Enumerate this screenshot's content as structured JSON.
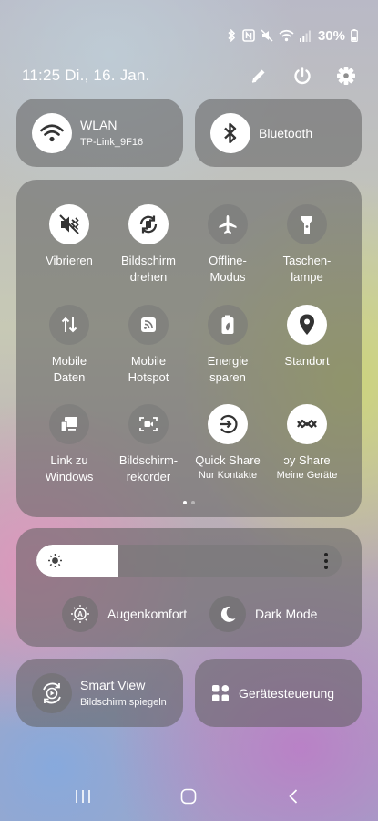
{
  "status_bar": {
    "battery": "30%"
  },
  "header": {
    "time_date": "11:25  Di., 16. Jan."
  },
  "tiles": {
    "wlan": {
      "title": "WLAN",
      "subtitle": "TP-Link_9F16"
    },
    "bluetooth": {
      "title": "Bluetooth"
    }
  },
  "quick": [
    {
      "label": "Vibrieren",
      "sub": ""
    },
    {
      "label": "Bildschirm\ndrehen",
      "sub": ""
    },
    {
      "label": "Offline-\nModus",
      "sub": ""
    },
    {
      "label": "Taschen-\nlampe",
      "sub": ""
    },
    {
      "label": "Mobile\nDaten",
      "sub": ""
    },
    {
      "label": "Mobile\nHotspot",
      "sub": ""
    },
    {
      "label": "Energie\nsparen",
      "sub": ""
    },
    {
      "label": "Standort",
      "sub": ""
    },
    {
      "label": "Link zu\nWindows",
      "sub": ""
    },
    {
      "label": "Bildschirm-\nrekorder",
      "sub": ""
    },
    {
      "label": "Quick Share",
      "sub": "Nur Kontakte"
    },
    {
      "label": "ɔy Share",
      "sub": "Meine Geräte"
    }
  ],
  "brightness": {
    "level": 0.27
  },
  "modes": {
    "eye_comfort": "Augenkomfort",
    "dark_mode": "Dark Mode"
  },
  "smart_view": {
    "title": "Smart View",
    "subtitle": "Bildschirm spiegeln"
  },
  "device_control": {
    "title": "Gerätesteuerung"
  },
  "colors": {
    "tile_bg": "#5f5f5f",
    "active": "#ffffff",
    "icon_dark": "#333333"
  }
}
